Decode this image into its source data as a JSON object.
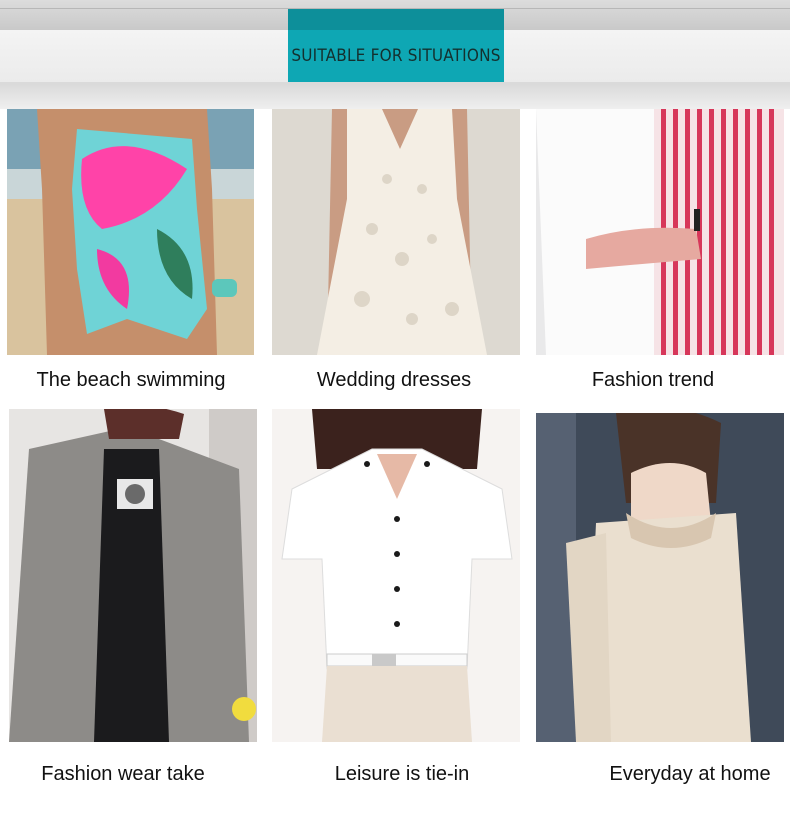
{
  "header": {
    "title": "SUITABLE FOR SITUATIONS"
  },
  "situations": [
    {
      "label": "The beach swimming"
    },
    {
      "label": "Wedding dresses"
    },
    {
      "label": "Fashion trend"
    },
    {
      "label": "Fashion wear take"
    },
    {
      "label": "Leisure is tie-in"
    },
    {
      "label": "Everyday at home"
    }
  ],
  "colors": {
    "accent": "#0ea7b4",
    "banner_bg": "#efefef"
  }
}
